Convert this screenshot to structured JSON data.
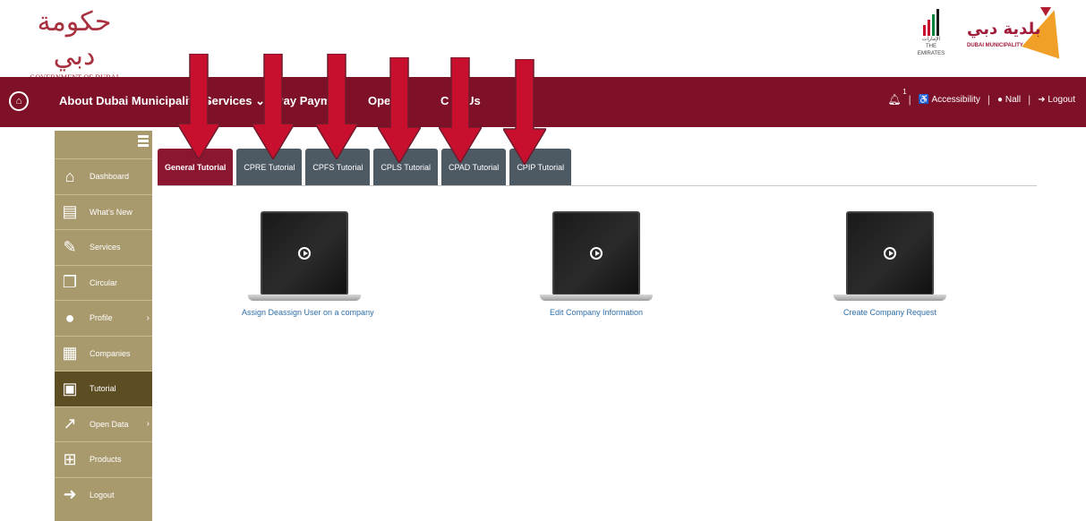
{
  "header": {
    "gov_logo_calligraphy": "حكومة دبي",
    "gov_logo_text": "GOVERNMENT OF DUBAI",
    "uae_logo_text_ar": "الإمارات",
    "uae_logo_text_en": "THE EMIRATES",
    "dm_logo_ar": "بلدية دبي",
    "dm_logo_en": "DUBAI MUNICIPALITY",
    "brand_colors": {
      "nav": "#7e1128",
      "sidebar": "#a99a6e",
      "active_tab": "#8b1630",
      "arrow": "#c8102e"
    }
  },
  "nav": {
    "home_icon": "home-icon",
    "items": [
      "About Dubai Municipality",
      "Services",
      "Pay Payme",
      "Ope a",
      "C ct Us"
    ],
    "items_suffix": [
      "⌄",
      "⌄",
      "",
      "",
      ""
    ],
    "notifications_count": "1",
    "accessibility": "Accessibility",
    "user": "Nall",
    "logout": "Logout"
  },
  "sidebar": {
    "items": [
      {
        "label": "Dashboard",
        "icon": "home-icon",
        "glyph": "⌂",
        "chevron": ""
      },
      {
        "label": "What's New",
        "icon": "newspaper-icon",
        "glyph": "▤",
        "chevron": ""
      },
      {
        "label": "Services",
        "icon": "wrench-icon",
        "glyph": "✎",
        "chevron": ""
      },
      {
        "label": "Circular",
        "icon": "copy-icon",
        "glyph": "❐",
        "chevron": ""
      },
      {
        "label": "Profile",
        "icon": "user-icon",
        "glyph": "●",
        "chevron": "›"
      },
      {
        "label": "Companies",
        "icon": "building-icon",
        "glyph": "▦",
        "chevron": ""
      },
      {
        "label": "Tutorial",
        "icon": "video-file-icon",
        "glyph": "▣",
        "chevron": ""
      },
      {
        "label": "Open Data",
        "icon": "chart-line-icon",
        "glyph": "↗",
        "chevron": "›"
      },
      {
        "label": "Products",
        "icon": "gift-icon",
        "glyph": "⊞",
        "chevron": ""
      },
      {
        "label": "Logout",
        "icon": "logout-icon",
        "glyph": "➜",
        "chevron": ""
      }
    ],
    "active_index": 6
  },
  "tabs": [
    {
      "label": "General Tutorial",
      "active": true
    },
    {
      "label": "CPRE Tutorial",
      "active": false
    },
    {
      "label": "CPFS Tutorial",
      "active": false
    },
    {
      "label": "CPLS Tutorial",
      "active": false
    },
    {
      "label": "CPAD Tutorial",
      "active": false
    },
    {
      "label": "CPIP Tutorial",
      "active": false
    }
  ],
  "videos": [
    {
      "title": "Assign Deassign User on a company"
    },
    {
      "title": "Edit Company Information"
    },
    {
      "title": "Create Company Request"
    }
  ]
}
